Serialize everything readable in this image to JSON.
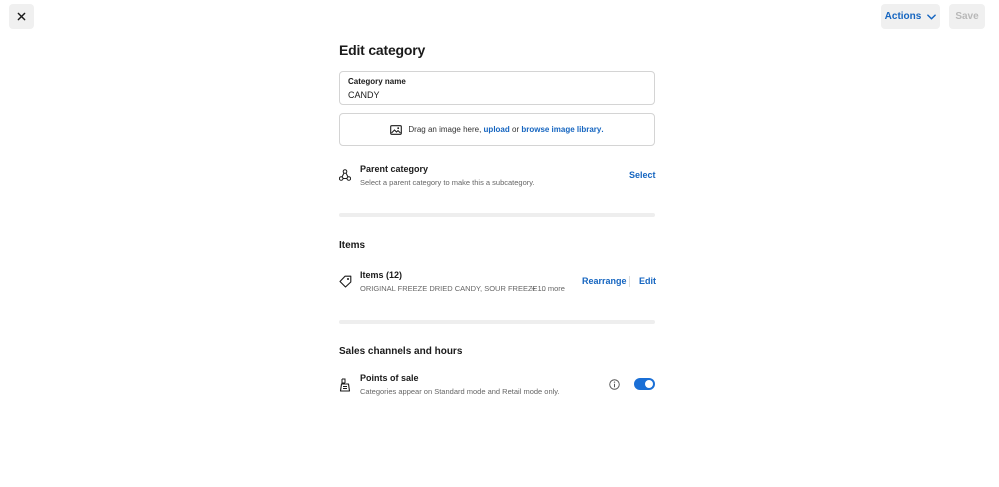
{
  "toolbar": {
    "actions_label": "Actions",
    "save_label": "Save"
  },
  "page": {
    "title": "Edit category"
  },
  "category_name": {
    "label": "Category name",
    "value": "CANDY"
  },
  "image_drop": {
    "text_before": "Drag an image here, ",
    "upload_link": "upload",
    "text_middle": " or ",
    "browse_link": "browse image library",
    "text_after": "."
  },
  "parent_category": {
    "title": "Parent category",
    "subtitle": "Select a parent category to make this a subcategory.",
    "select_label": "Select"
  },
  "items_section": {
    "title": "Items",
    "row_title": "Items (12)",
    "row_subtitle": "ORIGINAL FREEZE DRIED CANDY, SOUR FREEZE ...",
    "more_count": "+ 10 more",
    "rearrange_label": "Rearrange",
    "edit_label": "Edit"
  },
  "sales_section": {
    "title": "Sales channels and hours",
    "row_title": "Points of sale",
    "row_subtitle": "Categories appear on Standard mode and Retail mode only.",
    "toggle_on": true
  },
  "colors": {
    "accent": "#1565c0",
    "toggle": "#1a6fd6",
    "button_bg": "#f0f0f0",
    "disabled_text": "#b8b8b8"
  }
}
